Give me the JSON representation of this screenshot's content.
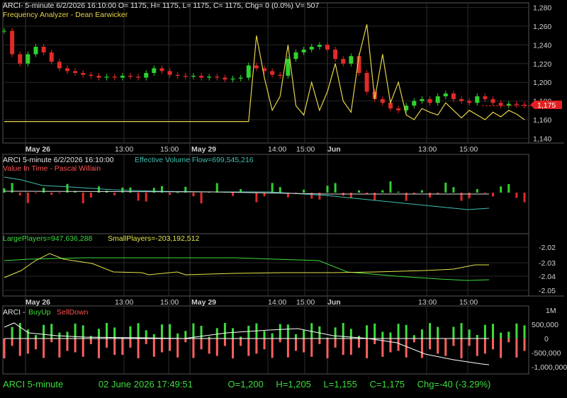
{
  "panel1": {
    "header": "ARCI- 5-minute 6/2/2026 16:10:00 O= 1175, H= 1175, L= 1175, C= 1175, Chg= 0 (0.0%) V= 507",
    "indicator": "Frequency Analyzer - Dean Earwicker",
    "y_ticks": [
      "1,280",
      "1,260",
      "1,240",
      "1,220",
      "1,200",
      "1,180",
      "1,160",
      "1,140"
    ],
    "price_tag": "1,175",
    "x_ticks": [
      "May 26",
      "13:00",
      "15:00",
      "May 29",
      "14:00",
      "15:00",
      "Jun",
      "13:00",
      "15:00"
    ]
  },
  "panel2": {
    "header_a": "ARCI 5-minute  6/2/2026 16:10:00",
    "header_b": "Effective Volume Flow=699,545,216",
    "indicator": "Value In Time - Pascal Willain"
  },
  "panel3": {
    "large": "LargePlayers=947,636,288",
    "small": "SmallPlayers=-203,192,512",
    "y_ticks": [
      "-2.02",
      "-2.03",
      "-2.04",
      "-2.05"
    ],
    "x_ticks": [
      "May 26",
      "13:00",
      "15:00",
      "May 29",
      "14:00",
      "15:00",
      "Jun",
      "13:00",
      "15:00"
    ]
  },
  "panel4": {
    "header_a": "ARCI - ",
    "header_b": "BuyUp",
    "header_c": "SellDown",
    "y_ticks": [
      "1M",
      "500,000",
      "0",
      "-500,000",
      "-1,000,000"
    ]
  },
  "status": {
    "symbol": "ARCI  5-minute",
    "datetime": "02 June 2026 17:49:51",
    "open": "O=1,200",
    "high": "H=1,205",
    "low": "L=1,155",
    "close": "C=1,175",
    "change": "Chg=-40 (-3.29%)"
  },
  "colors": {
    "up": "#2fd12f",
    "down": "#e02a2a",
    "freq": "#e6d24a",
    "evf": "#3fbfb0",
    "large": "#3ddc3d",
    "small": "#e6e64a",
    "grid": "#2a2a2a",
    "axis": "#cfcfcf",
    "buy": "#3ddc3d",
    "sell": "#ff6060",
    "tag": "#e02020"
  },
  "chart_data": [
    {
      "type": "candlestick",
      "title": "ARCI- 5-minute",
      "ylim": [
        1135,
        1285
      ],
      "y_ticks": [
        1280,
        1260,
        1240,
        1220,
        1200,
        1180,
        1160,
        1140
      ],
      "sessions": [
        "May 26",
        "May 29",
        "Jun 2"
      ],
      "close_path": [
        1255,
        1230,
        1220,
        1230,
        1238,
        1232,
        1222,
        1215,
        1212,
        1210,
        1208,
        1207,
        1205,
        1206,
        1205,
        1207,
        1206,
        1205,
        1210,
        1215,
        1212,
        1208,
        1207,
        1206,
        1207,
        1205,
        1206,
        1205,
        1203,
        1204,
        1205,
        1218,
        1215,
        1212,
        1208,
        1207,
        1225,
        1232,
        1235,
        1238,
        1240,
        1235,
        1225,
        1220,
        1228,
        1210,
        1190,
        1182,
        1178,
        1172,
        1170,
        1175,
        1180,
        1182,
        1178,
        1185,
        1188,
        1182,
        1180,
        1178,
        1185,
        1182,
        1178,
        1175,
        1177,
        1176,
        1175
      ],
      "last_price": 1175
    },
    {
      "type": "line",
      "title": "Frequency Analyzer - Dean Earwicker",
      "values": [
        1158,
        1158,
        1158,
        1158,
        1158,
        1158,
        1158,
        1158,
        1158,
        1158,
        1158,
        1158,
        1158,
        1158,
        1158,
        1158,
        1158,
        1158,
        1158,
        1158,
        1158,
        1158,
        1158,
        1158,
        1158,
        1158,
        1158,
        1158,
        1158,
        1158,
        1158,
        1158,
        1250,
        1205,
        1170,
        1185,
        1240,
        1175,
        1165,
        1200,
        1170,
        1190,
        1220,
        1180,
        1168,
        1228,
        1262,
        1182,
        1230,
        1178,
        1200,
        1165,
        1160,
        1172,
        1168,
        1165,
        1178,
        1170,
        1162,
        1170,
        1165,
        1160,
        1168,
        1163,
        1170,
        1166,
        1160
      ]
    },
    {
      "type": "bar",
      "title": "Value In Time - Pascal Willain",
      "series_name": "Effective Volume Flow",
      "value_label": "699,545,216"
    },
    {
      "type": "line",
      "series": [
        {
          "name": "LargePlayers",
          "value_label": "947,636,288"
        },
        {
          "name": "SmallPlayers",
          "value_label": "-203,192,512"
        }
      ],
      "y_ticks": [
        -2.02,
        -2.03,
        -2.04,
        -2.05
      ]
    },
    {
      "type": "bar",
      "title": "BuyUp-SellDown",
      "y_ticks": [
        "1M",
        "500,000",
        "0",
        "-500,000",
        "-1,000,000"
      ],
      "ylim": [
        -1150000,
        1100000
      ]
    }
  ]
}
